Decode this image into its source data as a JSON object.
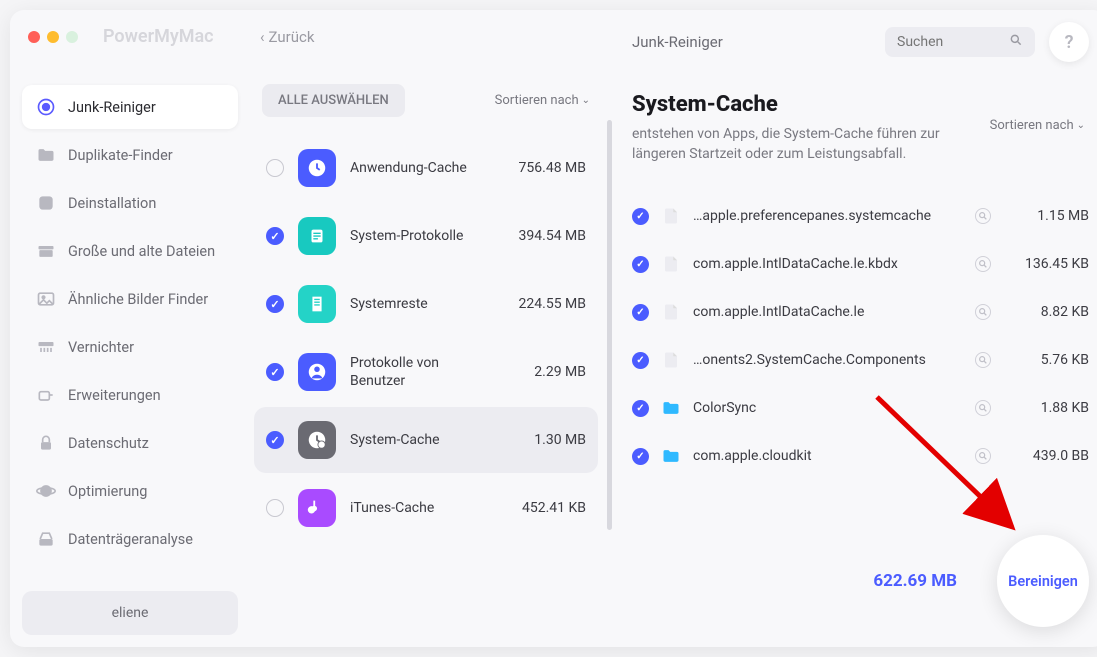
{
  "app": {
    "name": "PowerMyMac",
    "back": "Zurück"
  },
  "sidebar": {
    "items": [
      {
        "label": "Junk-Reiniger"
      },
      {
        "label": "Duplikate-Finder"
      },
      {
        "label": "Deinstallation"
      },
      {
        "label": "Große und alte Dateien"
      },
      {
        "label": "Ähnliche Bilder Finder"
      },
      {
        "label": "Vernichter"
      },
      {
        "label": "Erweiterungen"
      },
      {
        "label": "Datenschutz"
      },
      {
        "label": "Optimierung"
      },
      {
        "label": "Datenträgeranalyse"
      }
    ],
    "user": "eliene"
  },
  "middle": {
    "select_all": "ALLE AUSWÄHLEN",
    "sort_label": "Sortieren nach",
    "categories": [
      {
        "name": "Anwendung-Cache",
        "size": "756.48 MB",
        "checked": false,
        "color": "#4b5cff"
      },
      {
        "name": "System-Protokolle",
        "size": "394.54 MB",
        "checked": true,
        "color": "#18c9c0"
      },
      {
        "name": "Systemreste",
        "size": "224.55 MB",
        "checked": true,
        "color": "#24d3c7"
      },
      {
        "name": "Protokolle von Benutzer",
        "size": "2.29 MB",
        "checked": true,
        "color": "#4b5cff"
      },
      {
        "name": "System-Cache",
        "size": "1.30 MB",
        "checked": true,
        "color": "#6a6a72",
        "selected": true
      },
      {
        "name": "iTunes-Cache",
        "size": "452.41 KB",
        "checked": false,
        "color": "#a94bff"
      }
    ]
  },
  "detail": {
    "breadcrumb": "Junk-Reiniger",
    "search_placeholder": "Suchen",
    "title": "System-Cache",
    "subtitle": "entstehen von Apps, die System-Cache führen zur längeren Startzeit oder zum Leistungsabfall.",
    "sort_label": "Sortieren nach",
    "files": [
      {
        "name": "…apple.preferencepanes.systemcache",
        "size": "1.15 MB",
        "type": "file"
      },
      {
        "name": "com.apple.IntlDataCache.le.kbdx",
        "size": "136.45 KB",
        "type": "file"
      },
      {
        "name": "com.apple.IntlDataCache.le",
        "size": "8.82 KB",
        "type": "file"
      },
      {
        "name": "…onents2.SystemCache.Components",
        "size": "5.76 KB",
        "type": "file"
      },
      {
        "name": "ColorSync",
        "size": "1.88 KB",
        "type": "folder"
      },
      {
        "name": "com.apple.cloudkit",
        "size": "439.0 BB",
        "type": "folder"
      }
    ],
    "total": "622.69 MB",
    "clean": "Bereinigen"
  }
}
